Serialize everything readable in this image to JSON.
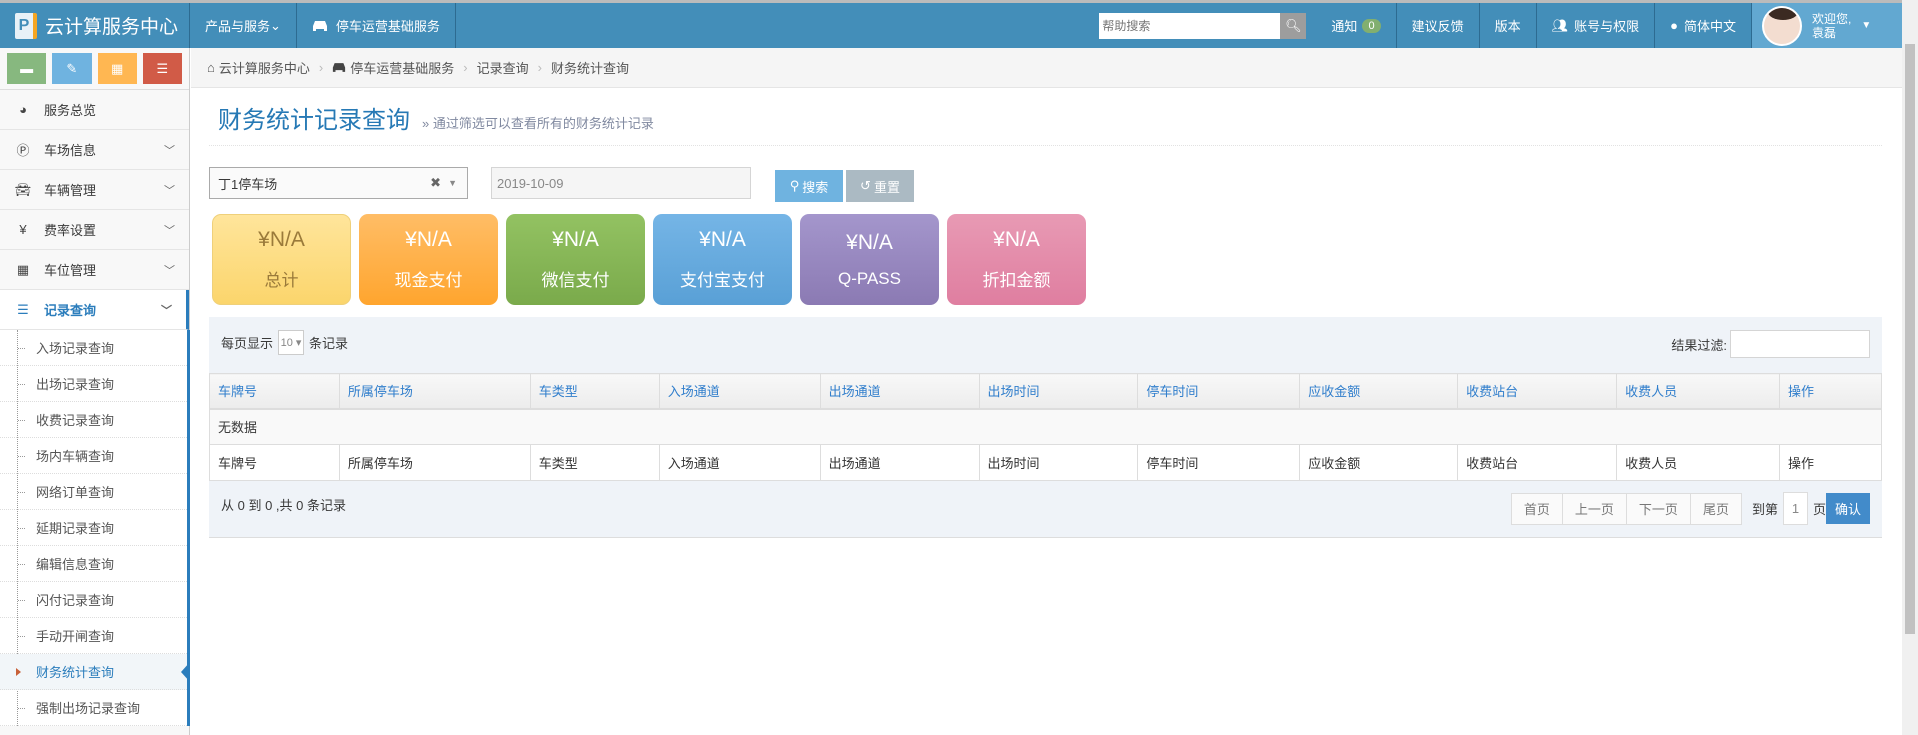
{
  "navbar": {
    "brand": "云计算服务中心",
    "products": "产品与服务",
    "parking_service": "停车运营基础服务",
    "search_placeholder": "帮助搜索",
    "notice": "通知",
    "notice_count": "0",
    "feedback": "建议反馈",
    "version": "版本",
    "account": "账号与权限",
    "language": "简体中文",
    "welcome": "欢迎您,",
    "user_name": "袁磊"
  },
  "sidebar": {
    "items": [
      {
        "label": "服务总览"
      },
      {
        "label": "车场信息"
      },
      {
        "label": "车辆管理"
      },
      {
        "label": "费率设置"
      },
      {
        "label": "车位管理"
      },
      {
        "label": "记录查询"
      }
    ],
    "sub_items": [
      "入场记录查询",
      "出场记录查询",
      "收费记录查询",
      "场内车辆查询",
      "网络订单查询",
      "延期记录查询",
      "编辑信息查询",
      "闪付记录查询",
      "手动开闸查询",
      "财务统计查询",
      "强制出场记录查询"
    ]
  },
  "breadcrumb": [
    "云计算服务中心",
    "停车运营基础服务",
    "记录查询",
    "财务统计查询"
  ],
  "page": {
    "title": "财务统计记录查询",
    "subtitle": "通过筛选可以查看所有的财务统计记录"
  },
  "filters": {
    "parking_lot": "丁1停车场",
    "date": "2019-10-09",
    "search": "搜索",
    "reset": "重置"
  },
  "cards": [
    {
      "value": "¥N/A",
      "label": "总计",
      "color": "#fbd774"
    },
    {
      "value": "¥N/A",
      "label": "现金支付",
      "color": "#ffa833"
    },
    {
      "value": "¥N/A",
      "label": "微信支付",
      "color": "#84b355"
    },
    {
      "value": "¥N/A",
      "label": "支付宝支付",
      "color": "#5fa6dc"
    },
    {
      "value": "¥N/A",
      "label": "Q-PASS",
      "color": "#8f7fb5"
    },
    {
      "value": "¥N/A",
      "label": "折扣金额",
      "color": "#e383a3"
    }
  ],
  "table": {
    "per_page_prefix": "每页显示",
    "per_page": "10",
    "per_page_suffix": "条记录",
    "filter_label": "结果过滤:",
    "columns": [
      "车牌号",
      "所属停车场",
      "车类型",
      "入场通道",
      "出场通道",
      "出场时间",
      "停车时间",
      "应收金额",
      "收费站台",
      "收费人员",
      "操作"
    ],
    "empty": "无数据",
    "info": "从 0 到 0 ,共 0 条记录"
  },
  "pager": {
    "first": "首页",
    "prev": "上一页",
    "next": "下一页",
    "last": "尾页",
    "goto_prefix": "到第",
    "page": "1",
    "goto_suffix": "页",
    "confirm": "确认"
  }
}
